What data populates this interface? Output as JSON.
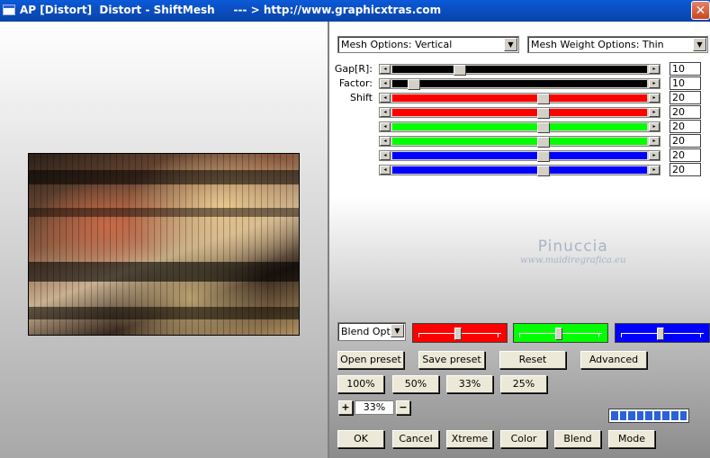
{
  "window": {
    "title": "AP [Distort]  Distort - ShiftMesh     --- > http://www.graphicxtras.com",
    "close_glyph": "✕"
  },
  "dropdowns": {
    "mesh_options": "Mesh Options: Vertical",
    "mesh_weight": "Mesh Weight Options: Thin",
    "blend_options": "Blend Optio",
    "arrow": "▼"
  },
  "sliders": [
    {
      "label": "Gap[R]:",
      "value": "10",
      "fraction": 0.24,
      "colors": [
        "#000000",
        "#000000"
      ]
    },
    {
      "label": "Factor:",
      "value": "10",
      "fraction": 0.06,
      "colors": [
        "#000000",
        "#000000"
      ]
    },
    {
      "label": "Shift",
      "value": "20",
      "fraction": 0.57,
      "colors": [
        "#ff0000",
        "#ff0000"
      ]
    },
    {
      "label": "",
      "value": "20",
      "fraction": 0.57,
      "colors": [
        "#ff0000",
        "#ff0000"
      ]
    },
    {
      "label": "",
      "value": "20",
      "fraction": 0.57,
      "colors": [
        "#00ff00",
        "#00ff00"
      ]
    },
    {
      "label": "",
      "value": "20",
      "fraction": 0.57,
      "colors": [
        "#00ff00",
        "#00ff00"
      ]
    },
    {
      "label": "",
      "value": "20",
      "fraction": 0.57,
      "colors": [
        "#0000ff",
        "#0000ff"
      ]
    },
    {
      "label": "",
      "value": "20",
      "fraction": 0.57,
      "colors": [
        "#0000ff",
        "#0000ff"
      ]
    }
  ],
  "slider_arrows": {
    "left": "◂",
    "right": "▸"
  },
  "watermark": {
    "line1": "Pinuccia",
    "line2": "www.maidiregrafica.eu"
  },
  "color_sliders": [
    {
      "name": "red",
      "color": "#ff0000",
      "fraction": 0.5
    },
    {
      "name": "green",
      "color": "#00ff00",
      "fraction": 0.5
    },
    {
      "name": "blue",
      "color": "#0000ff",
      "fraction": 0.5
    }
  ],
  "buttons": {
    "open_preset": "Open preset",
    "save_preset": "Save preset",
    "reset": "Reset",
    "advanced": "Advanced",
    "zoom_100": "100%",
    "zoom_50": "50%",
    "zoom_33": "33%",
    "zoom_25": "25%",
    "plus": "+",
    "minus": "−",
    "ok": "OK",
    "cancel": "Cancel",
    "xtreme": "Xtreme",
    "color": "Color",
    "blend": "Blend",
    "mode": "Mode"
  },
  "zoom": {
    "current": "33%"
  },
  "progress": {
    "segments": 9
  }
}
